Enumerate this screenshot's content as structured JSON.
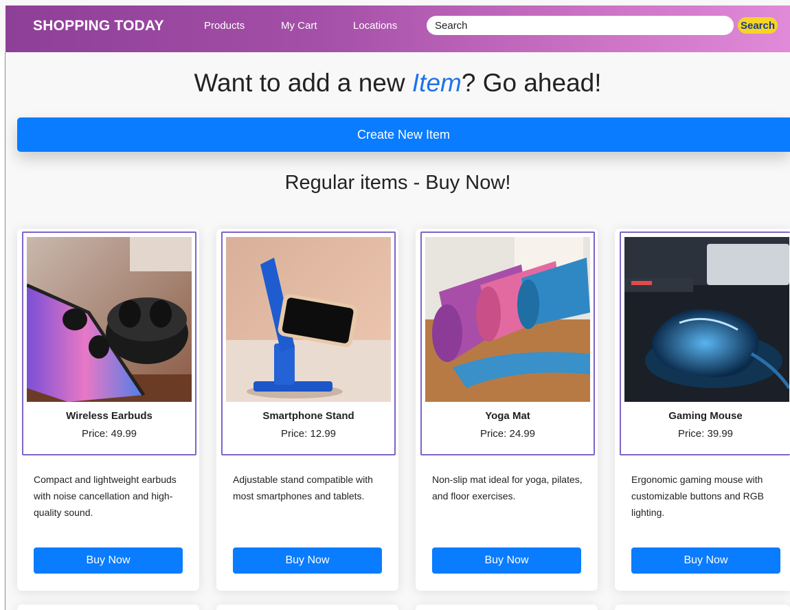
{
  "navbar": {
    "brand": "SHOPPING TODAY",
    "links": [
      "Products",
      "My Cart",
      "Locations"
    ],
    "search_placeholder": "Search",
    "search_button": "Search"
  },
  "page": {
    "heading_pre": "Want to add a new ",
    "heading_accent": "Item",
    "heading_post": "? Go ahead!",
    "create_button": "Create New Item",
    "section_heading": "Regular items - Buy Now!"
  },
  "products": [
    {
      "name": "Wireless Earbuds",
      "price": "Price: 49.99",
      "description": "Compact and lightweight earbuds with noise cancellation and high-quality sound.",
      "button": "Buy Now"
    },
    {
      "name": "Smartphone Stand",
      "price": "Price: 12.99",
      "description": "Adjustable stand compatible with most smartphones and tablets.",
      "button": "Buy Now"
    },
    {
      "name": "Yoga Mat",
      "price": "Price: 24.99",
      "description": "Non-slip mat ideal for yoga, pilates, and floor exercises.",
      "button": "Buy Now"
    },
    {
      "name": "Gaming Mouse",
      "price": "Price: 39.99",
      "description": "Ergonomic gaming mouse with customizable buttons and RGB lighting.",
      "button": "Buy Now"
    }
  ],
  "colors": {
    "navbar_gradient_start": "#8e3f97",
    "navbar_gradient_end": "#e08ad8",
    "primary_button": "#0a7cff",
    "search_button": "#f5d427",
    "card_border": "#7d63c7",
    "heading_accent": "#1f72e8"
  }
}
